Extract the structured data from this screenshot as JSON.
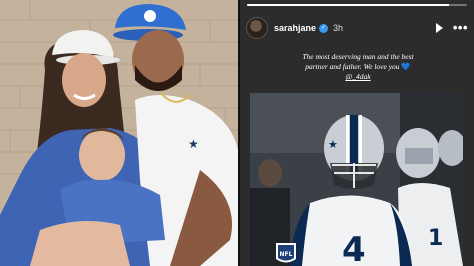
{
  "story": {
    "username": "sarahjane",
    "verified_mark": "✓",
    "time_ago": "3h",
    "progress": 0.92,
    "caption_line1": "The most deserving man and the best",
    "caption_line2": "partner and father. We love you",
    "caption_heart": "💙",
    "caption_mention": "@_4dak",
    "icons": [
      "play-icon",
      "more-options-icon",
      "verified-badge-icon"
    ]
  },
  "photos": {
    "left_jersey_number": "4",
    "nfl_badge_text": "NFL",
    "helmet_star": "★"
  },
  "colors": {
    "story_background": "#2c2c2c",
    "verified_blue": "#3897f0",
    "heart_blue": "#3d9bf5",
    "cowboys_navy": "#0b2a53"
  }
}
